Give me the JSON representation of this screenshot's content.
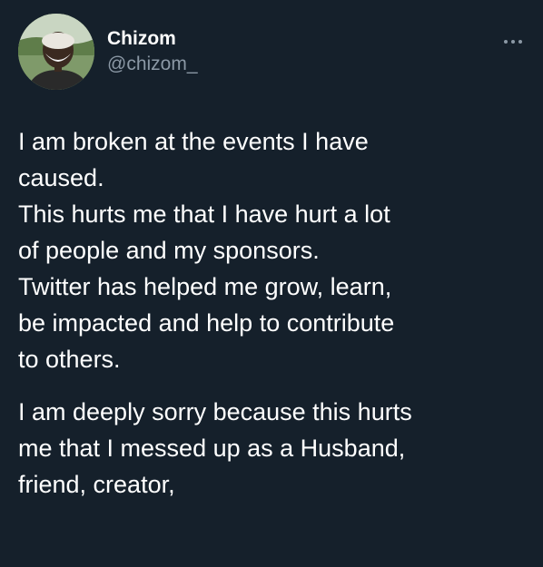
{
  "tweet": {
    "author": {
      "display_name": "Chizom",
      "handle": "@chizom_",
      "avatar_icon": "user-avatar-photo"
    },
    "more_icon": "more-dots-icon",
    "paragraphs": [
      {
        "lines": [
          "I am broken at the events I have",
          "caused.",
          "This hurts me that I have hurt a lot",
          "of people and my sponsors.",
          "Twitter has helped me grow, learn,",
          "be impacted and help to contribute",
          "to others."
        ]
      },
      {
        "lines": [
          "I am deeply sorry because this hurts",
          "me that I messed up as a Husband,",
          "friend, creator,"
        ]
      }
    ]
  },
  "colors": {
    "background": "#15202b",
    "primary_text": "#ffffff",
    "secondary_text": "#8b98a5"
  }
}
